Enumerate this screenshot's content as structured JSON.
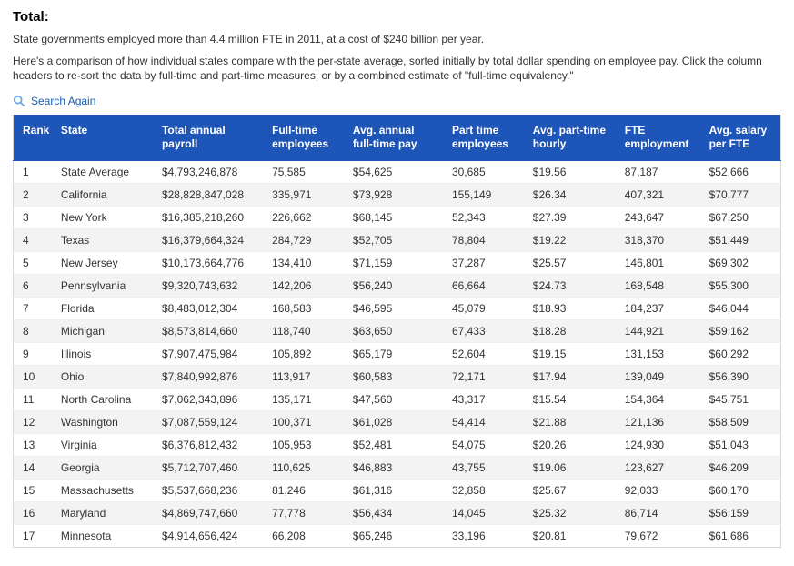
{
  "title": "Total:",
  "intro1": "State governments employed more than 4.4 million FTE in 2011, at a cost of $240 billion per year.",
  "intro2": "Here's a comparison of how individual states compare with the per-state average, sorted initially by total dollar spending on employee pay. Click the column headers to re-sort the data by full-time and part-time measures, or by a combined estimate of \"full-time equivalency.\"",
  "search_again": "Search Again",
  "columns": {
    "rank": "Rank",
    "state": "State",
    "pay": "Total annual payroll",
    "ft": "Full-time employees",
    "avgft": "Avg. annual full-time pay",
    "pt": "Part time employees",
    "ptavg": "Avg. part-time hourly",
    "ftee": "FTE employment",
    "avgfte": "Avg. salary per FTE"
  },
  "chart_data": {
    "type": "table",
    "columns": [
      "Rank",
      "State",
      "Total annual payroll",
      "Full-time employees",
      "Avg. annual full-time pay",
      "Part time employees",
      "Avg. part-time hourly",
      "FTE employment",
      "Avg. salary per FTE"
    ],
    "rows": [
      {
        "rank": "1",
        "state": "State Average",
        "pay": "$4,793,246,878",
        "ft": "75,585",
        "avgft": "$54,625",
        "pt": "30,685",
        "ptavg": "$19.56",
        "ftee": "87,187",
        "avgfte": "$52,666"
      },
      {
        "rank": "2",
        "state": "California",
        "pay": "$28,828,847,028",
        "ft": "335,971",
        "avgft": "$73,928",
        "pt": "155,149",
        "ptavg": "$26.34",
        "ftee": "407,321",
        "avgfte": "$70,777"
      },
      {
        "rank": "3",
        "state": "New York",
        "pay": "$16,385,218,260",
        "ft": "226,662",
        "avgft": "$68,145",
        "pt": "52,343",
        "ptavg": "$27.39",
        "ftee": "243,647",
        "avgfte": "$67,250"
      },
      {
        "rank": "4",
        "state": "Texas",
        "pay": "$16,379,664,324",
        "ft": "284,729",
        "avgft": "$52,705",
        "pt": "78,804",
        "ptavg": "$19.22",
        "ftee": "318,370",
        "avgfte": "$51,449"
      },
      {
        "rank": "5",
        "state": "New Jersey",
        "pay": "$10,173,664,776",
        "ft": "134,410",
        "avgft": "$71,159",
        "pt": "37,287",
        "ptavg": "$25.57",
        "ftee": "146,801",
        "avgfte": "$69,302"
      },
      {
        "rank": "6",
        "state": "Pennsylvania",
        "pay": "$9,320,743,632",
        "ft": "142,206",
        "avgft": "$56,240",
        "pt": "66,664",
        "ptavg": "$24.73",
        "ftee": "168,548",
        "avgfte": "$55,300"
      },
      {
        "rank": "7",
        "state": "Florida",
        "pay": "$8,483,012,304",
        "ft": "168,583",
        "avgft": "$46,595",
        "pt": "45,079",
        "ptavg": "$18.93",
        "ftee": "184,237",
        "avgfte": "$46,044"
      },
      {
        "rank": "8",
        "state": "Michigan",
        "pay": "$8,573,814,660",
        "ft": "118,740",
        "avgft": "$63,650",
        "pt": "67,433",
        "ptavg": "$18.28",
        "ftee": "144,921",
        "avgfte": "$59,162"
      },
      {
        "rank": "9",
        "state": "Illinois",
        "pay": "$7,907,475,984",
        "ft": "105,892",
        "avgft": "$65,179",
        "pt": "52,604",
        "ptavg": "$19.15",
        "ftee": "131,153",
        "avgfte": "$60,292"
      },
      {
        "rank": "10",
        "state": "Ohio",
        "pay": "$7,840,992,876",
        "ft": "113,917",
        "avgft": "$60,583",
        "pt": "72,171",
        "ptavg": "$17.94",
        "ftee": "139,049",
        "avgfte": "$56,390"
      },
      {
        "rank": "11",
        "state": "North Carolina",
        "pay": "$7,062,343,896",
        "ft": "135,171",
        "avgft": "$47,560",
        "pt": "43,317",
        "ptavg": "$15.54",
        "ftee": "154,364",
        "avgfte": "$45,751"
      },
      {
        "rank": "12",
        "state": "Washington",
        "pay": "$7,087,559,124",
        "ft": "100,371",
        "avgft": "$61,028",
        "pt": "54,414",
        "ptavg": "$21.88",
        "ftee": "121,136",
        "avgfte": "$58,509"
      },
      {
        "rank": "13",
        "state": "Virginia",
        "pay": "$6,376,812,432",
        "ft": "105,953",
        "avgft": "$52,481",
        "pt": "54,075",
        "ptavg": "$20.26",
        "ftee": "124,930",
        "avgfte": "$51,043"
      },
      {
        "rank": "14",
        "state": "Georgia",
        "pay": "$5,712,707,460",
        "ft": "110,625",
        "avgft": "$46,883",
        "pt": "43,755",
        "ptavg": "$19.06",
        "ftee": "123,627",
        "avgfte": "$46,209"
      },
      {
        "rank": "15",
        "state": "Massachusetts",
        "pay": "$5,537,668,236",
        "ft": "81,246",
        "avgft": "$61,316",
        "pt": "32,858",
        "ptavg": "$25.67",
        "ftee": "92,033",
        "avgfte": "$60,170"
      },
      {
        "rank": "16",
        "state": "Maryland",
        "pay": "$4,869,747,660",
        "ft": "77,778",
        "avgft": "$56,434",
        "pt": "14,045",
        "ptavg": "$25.32",
        "ftee": "86,714",
        "avgfte": "$56,159"
      },
      {
        "rank": "17",
        "state": "Minnesota",
        "pay": "$4,914,656,424",
        "ft": "66,208",
        "avgft": "$65,246",
        "pt": "33,196",
        "ptavg": "$20.81",
        "ftee": "79,672",
        "avgfte": "$61,686"
      }
    ]
  }
}
